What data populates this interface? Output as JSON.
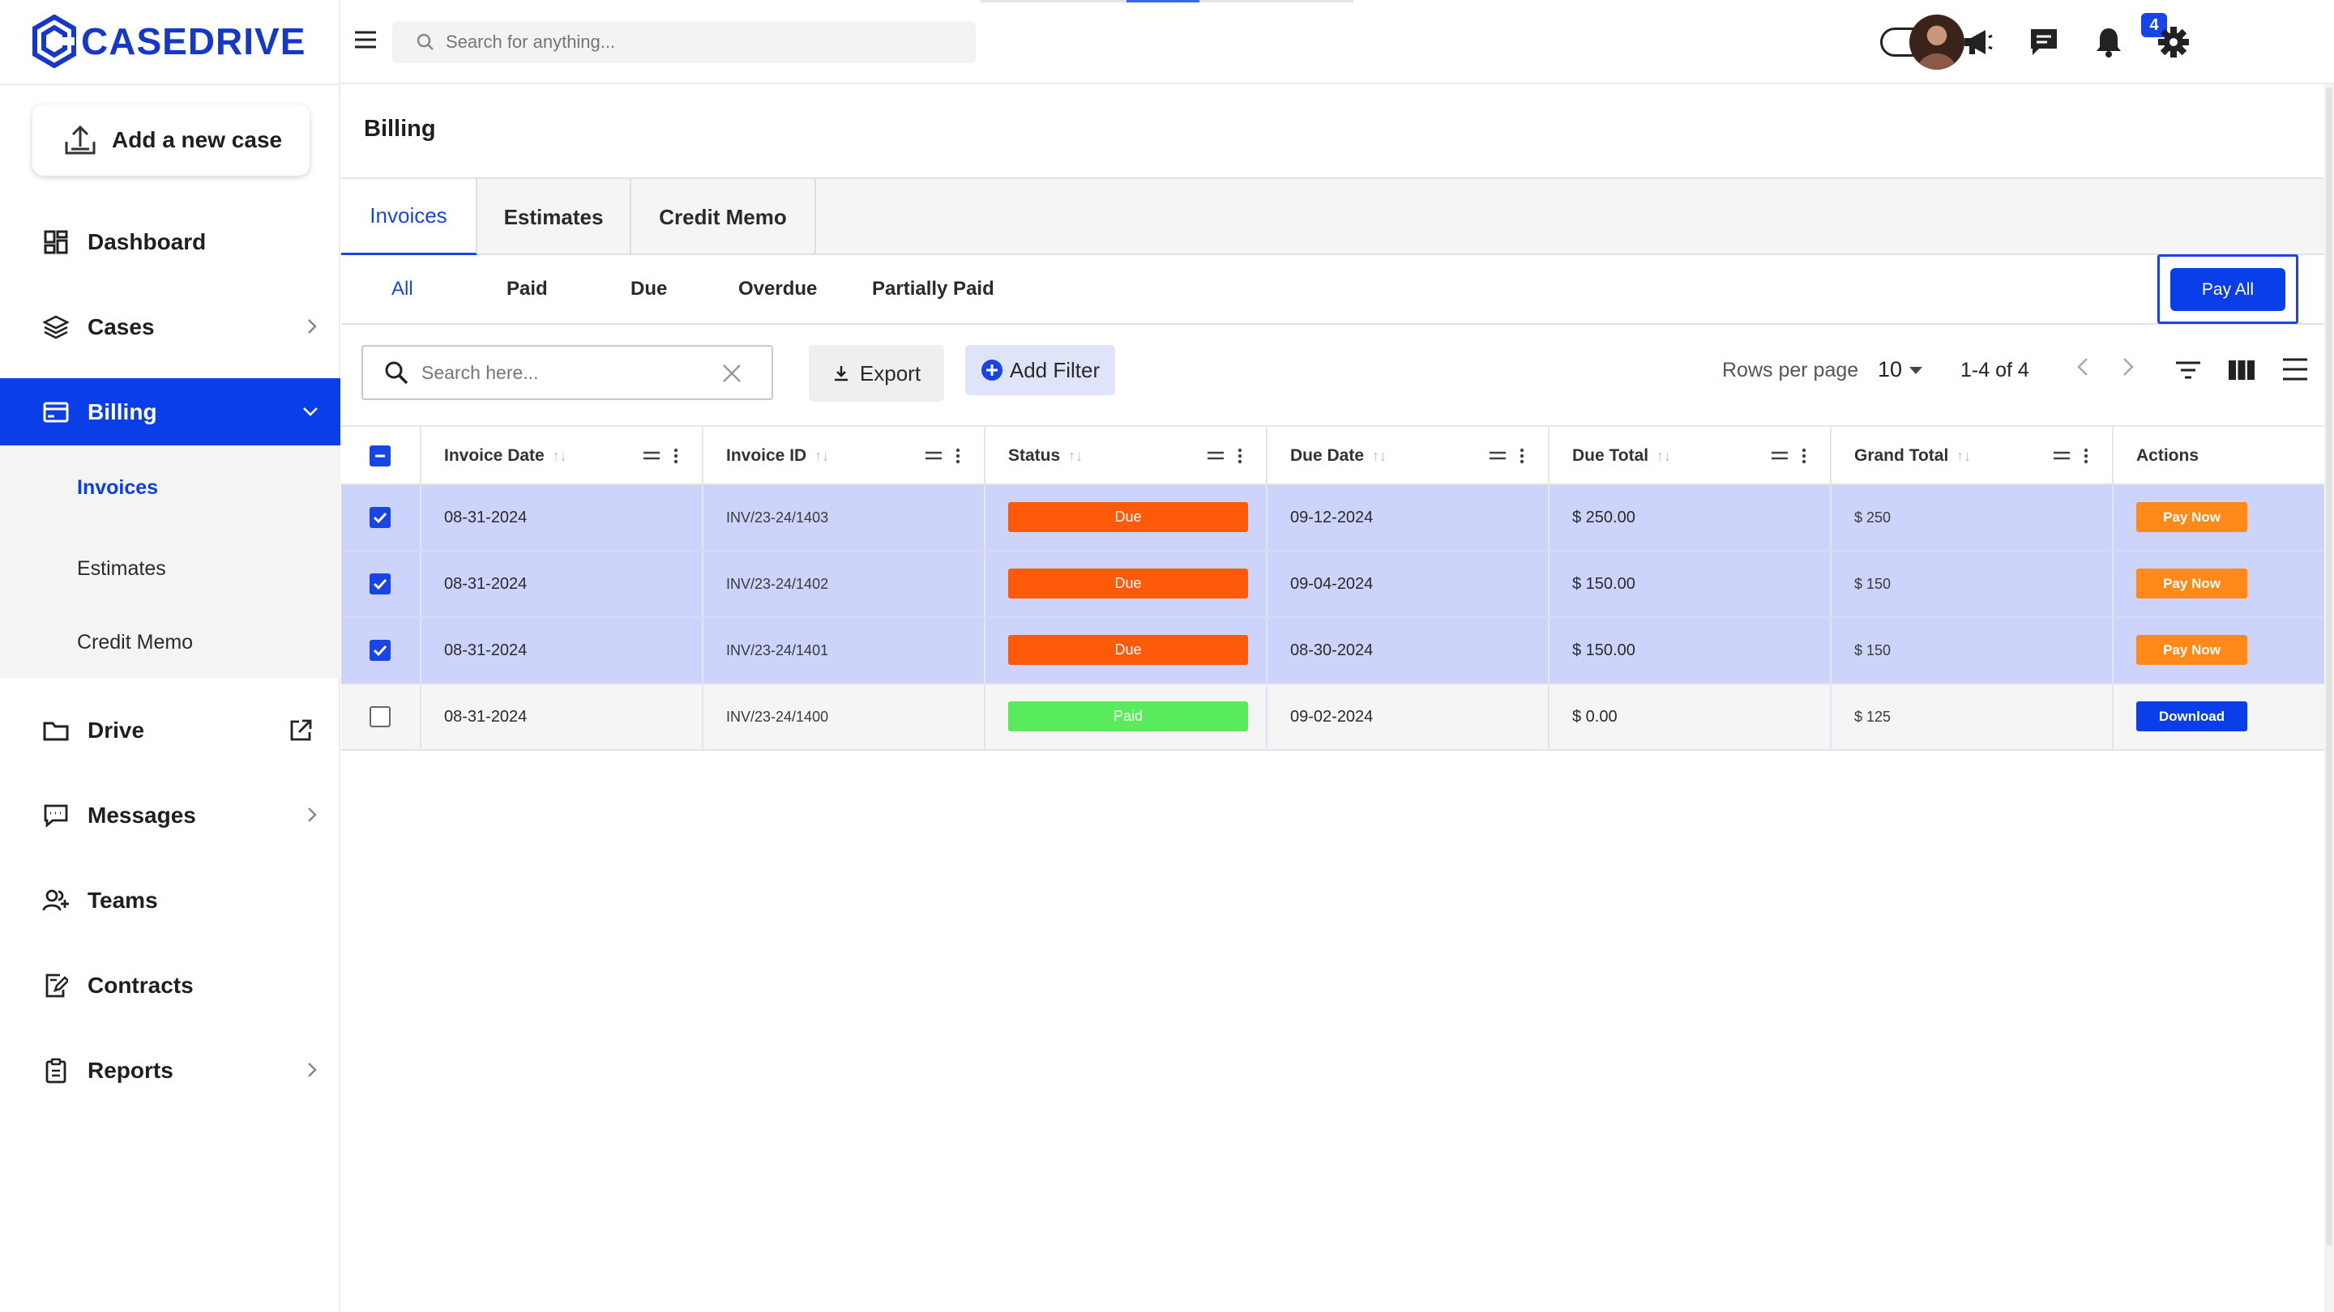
{
  "brand": {
    "name": "CASEDRIVE",
    "color": "#1538c9"
  },
  "colors": {
    "accent": "#0a3ee8",
    "due": "#ff5a0a",
    "paid": "#58eb5b",
    "pay_now": "#ff8a1a",
    "selected_row": "#cdd4fb"
  },
  "sidebar": {
    "add_case_label": "Add a new case",
    "items": [
      {
        "label": "Dashboard",
        "icon": "dashboard-icon"
      },
      {
        "label": "Cases",
        "icon": "layers-icon"
      },
      {
        "label": "Billing",
        "icon": "card-icon"
      },
      {
        "label": "Drive",
        "icon": "folder-icon"
      },
      {
        "label": "Messages",
        "icon": "chat-icon"
      },
      {
        "label": "Teams",
        "icon": "users-icon"
      },
      {
        "label": "Contracts",
        "icon": "contract-icon"
      },
      {
        "label": "Reports",
        "icon": "clipboard-icon"
      }
    ],
    "billing_sub": [
      "Invoices",
      "Estimates",
      "Credit Memo"
    ]
  },
  "topbar": {
    "search_placeholder": "Search for anything...",
    "notification_count": "4"
  },
  "page": {
    "title": "Billing",
    "tabs": [
      "Invoices",
      "Estimates",
      "Credit Memo"
    ],
    "filters": [
      "All",
      "Paid",
      "Due",
      "Overdue",
      "Partially Paid"
    ],
    "pay_all_label": "Pay All"
  },
  "toolbar": {
    "search_placeholder": "Search here...",
    "export_label": "Export",
    "add_filter_label": "Add Filter",
    "rows_per_page_label": "Rows per page",
    "rows_per_page_value": "10",
    "page_range": "1-4 of 4"
  },
  "table": {
    "columns": [
      "Invoice Date",
      "Invoice ID",
      "Status",
      "Due Date",
      "Due Total",
      "Grand Total",
      "Actions"
    ],
    "rows": [
      {
        "selected": true,
        "invoice_date": "08-31-2024",
        "invoice_id": "INV/23-24/1403",
        "status": "Due",
        "due_date": "09-12-2024",
        "due_total": "$ 250.00",
        "grand_total": "$ 250",
        "action": "Pay Now"
      },
      {
        "selected": true,
        "invoice_date": "08-31-2024",
        "invoice_id": "INV/23-24/1402",
        "status": "Due",
        "due_date": "09-04-2024",
        "due_total": "$ 150.00",
        "grand_total": "$ 150",
        "action": "Pay Now"
      },
      {
        "selected": true,
        "invoice_date": "08-31-2024",
        "invoice_id": "INV/23-24/1401",
        "status": "Due",
        "due_date": "08-30-2024",
        "due_total": "$ 150.00",
        "grand_total": "$ 150",
        "action": "Pay Now"
      },
      {
        "selected": false,
        "invoice_date": "08-31-2024",
        "invoice_id": "INV/23-24/1400",
        "status": "Paid",
        "due_date": "09-02-2024",
        "due_total": "$ 0.00",
        "grand_total": "$ 125",
        "action": "Download"
      }
    ]
  }
}
